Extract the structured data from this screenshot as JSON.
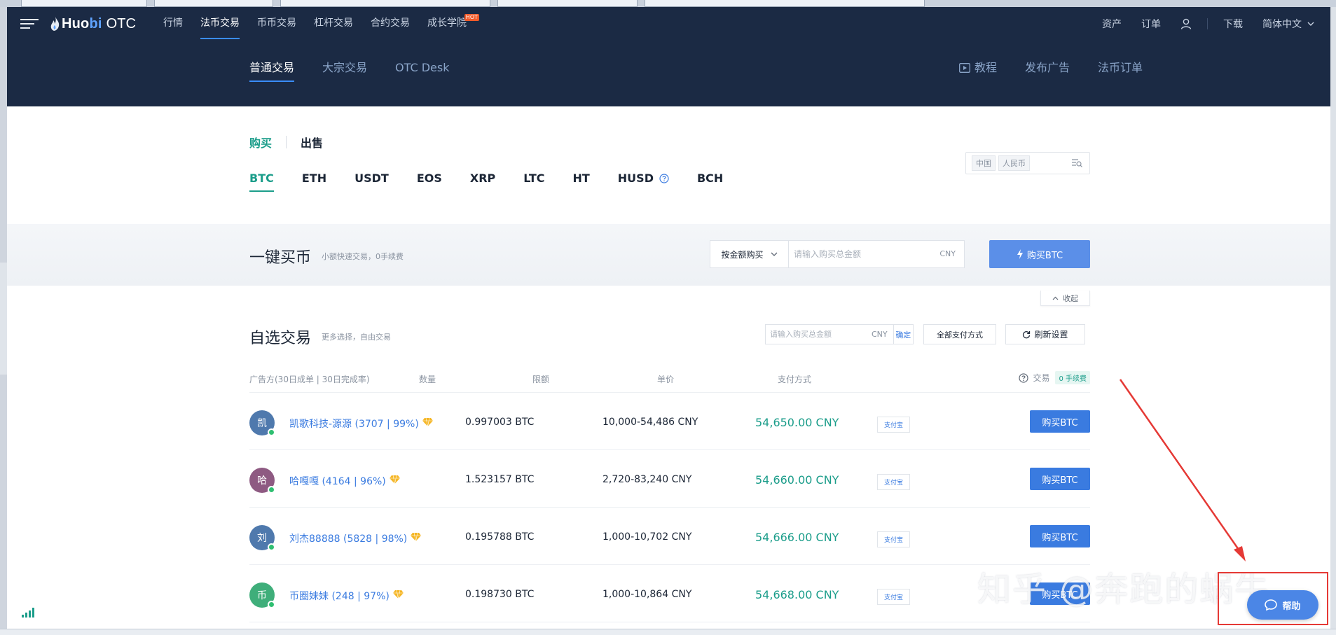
{
  "topnav": {
    "brand_a": "Huo",
    "brand_b": "bi",
    "brand_c": "OTC",
    "items": [
      "行情",
      "法币交易",
      "币币交易",
      "杠杆交易",
      "合约交易",
      "成长学院"
    ],
    "hot_badge": "HOT",
    "right": [
      "资产",
      "订单",
      "下载",
      "简体中文"
    ]
  },
  "subnav": {
    "tabs": [
      "普通交易",
      "大宗交易",
      "OTC Desk"
    ],
    "right": [
      "教程",
      "发布广告",
      "法币订单"
    ]
  },
  "trade_side": {
    "buy": "购买",
    "sell": "出售"
  },
  "coins": [
    "BTC",
    "ETH",
    "USDT",
    "EOS",
    "XRP",
    "LTC",
    "HT",
    "HUSD",
    "BCH"
  ],
  "region_filter": {
    "country": "中国",
    "currency": "人民币"
  },
  "quick_buy": {
    "title": "一键买币",
    "subtitle": "小额快速交易，0手续费",
    "mode": "按金额购买",
    "placeholder": "请输入购买总金额",
    "unit": "CNY",
    "button": "购买BTC"
  },
  "collapse_label": "收起",
  "custom_trade": {
    "title": "自选交易",
    "subtitle": "更多选择，自由交易",
    "amount_placeholder": "请输入购买总金额",
    "unit": "CNY",
    "confirm": "确定",
    "payment_filter": "全部支付方式",
    "refresh": "刷新设置"
  },
  "table": {
    "headers": {
      "advertiser": "广告方(30日成单 | 30日完成率)",
      "amount": "数量",
      "limit": "限额",
      "price": "单价",
      "payment": "支付方式",
      "trade": "交易",
      "fee": "0 手续费"
    },
    "rows": [
      {
        "avatar": "凯",
        "avatar_color": "#4f79ad",
        "name": "凯歌科技-源源 (3707 | 99%)",
        "amount": "0.997003 BTC",
        "limit": "10,000-54,486 CNY",
        "price": "54,650.00 CNY",
        "payment": "支付宝",
        "action": "购买BTC"
      },
      {
        "avatar": "哈",
        "avatar_color": "#8e5a82",
        "name": "哈嘎嘎 (4164 | 96%)",
        "amount": "1.523157 BTC",
        "limit": "2,720-83,240 CNY",
        "price": "54,660.00 CNY",
        "payment": "支付宝",
        "action": "购买BTC"
      },
      {
        "avatar": "刘",
        "avatar_color": "#4f79ad",
        "name": "刘杰88888 (5828 | 98%)",
        "amount": "0.195788 BTC",
        "limit": "1,000-10,702 CNY",
        "price": "54,666.00 CNY",
        "payment": "支付宝",
        "action": "购买BTC"
      },
      {
        "avatar": "币",
        "avatar_color": "#3fae7a",
        "name": "币圈妹妹 (248 | 97%)",
        "amount": "0.198730 BTC",
        "limit": "1,000-10,864 CNY",
        "price": "54,668.00 CNY",
        "payment": "支付宝",
        "action": "购买BTC"
      }
    ]
  },
  "help_button": "帮助",
  "watermark": "知乎 @奔跑的蜗牛",
  "colors": {
    "nav_bg": "#1b2a44",
    "accent_green": "#1b9d8a",
    "accent_blue": "#3a7be0",
    "annotation_red": "#e53935"
  }
}
